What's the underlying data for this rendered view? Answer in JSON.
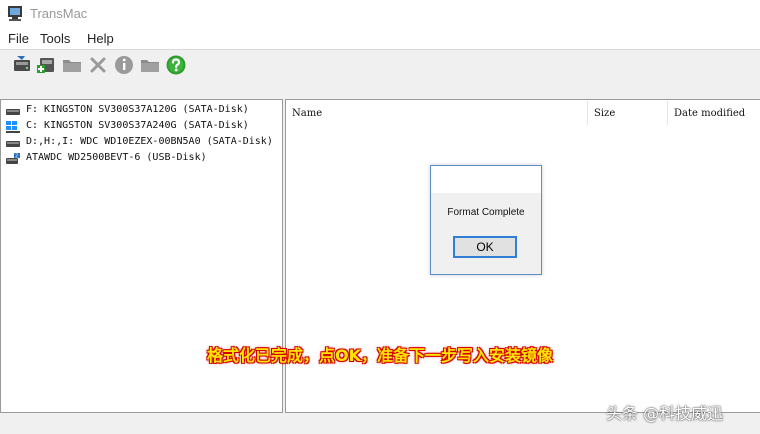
{
  "window": {
    "title": "TransMac"
  },
  "menu": [
    {
      "label": "File"
    },
    {
      "label": "Tools"
    },
    {
      "label": "Help"
    }
  ],
  "toolbar": {
    "buttons": [
      {
        "icon": "disk-open-icon"
      },
      {
        "icon": "disk-add-icon"
      },
      {
        "icon": "folder-icon"
      },
      {
        "icon": "delete-icon"
      },
      {
        "icon": "info-icon"
      },
      {
        "icon": "folder-new-icon"
      },
      {
        "icon": "help-icon"
      }
    ]
  },
  "disks": [
    {
      "label": "F: KINGSTON SV300S37A120G (SATA-Disk)",
      "icon": "drive-icon"
    },
    {
      "label": "C: KINGSTON SV300S37A240G (SATA-Disk)",
      "icon": "windows-drive-icon"
    },
    {
      "label": "D:,H:,I: WDC WD10EZEX-00BN5A0 (SATA-Disk)",
      "icon": "drive-icon"
    },
    {
      "label": "ATAWDC WD2500BEVT-6 (USB-Disk)",
      "icon": "usb-drive-icon"
    }
  ],
  "file_list": {
    "columns": [
      {
        "label": "Name"
      },
      {
        "label": "Size"
      },
      {
        "label": "Date modified"
      }
    ]
  },
  "dialog": {
    "message": "Format Complete",
    "ok_label": "OK"
  },
  "caption": "格式化已完成，点OK，准备下一步写入安装镜像",
  "watermark": "头条 @科技威迅",
  "colors": {
    "dialog_border": "#5a8fc9",
    "ok_focus": "#2f7fd6",
    "caption_fill": "#ffe600",
    "caption_stroke": "#d40000",
    "help_green": "#2e9b2e"
  }
}
